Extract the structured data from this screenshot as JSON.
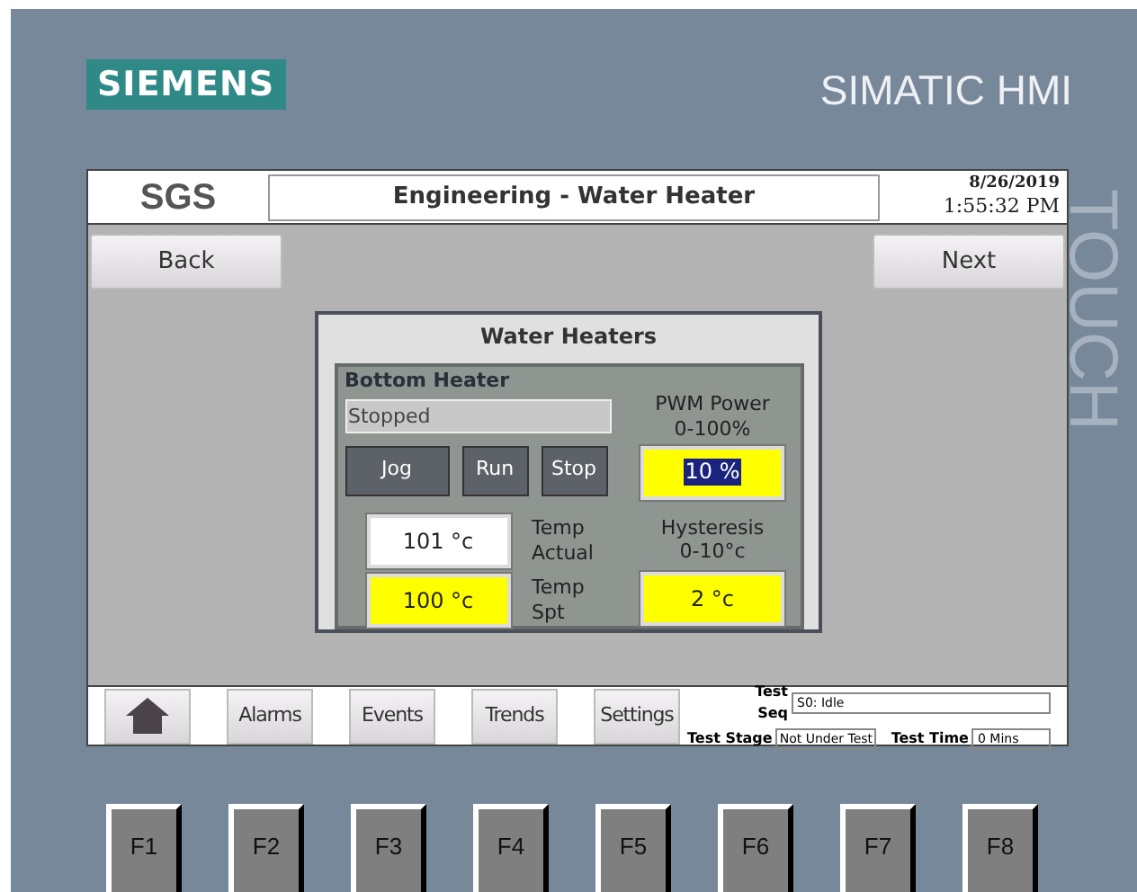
{
  "brand": {
    "logo": "SIEMENS",
    "model": "SIMATIC HMI",
    "side_label": "TOUCH"
  },
  "header": {
    "logo": "SGS",
    "title": "Engineering - Water Heater",
    "date": "8/26/2019",
    "time": "1:55:32 PM"
  },
  "nav": {
    "back": "Back",
    "next": "Next"
  },
  "dialog": {
    "title": "Water Heaters",
    "section": "Bottom Heater",
    "status": "Stopped",
    "buttons": [
      "Jog",
      "Run",
      "Stop"
    ],
    "pwm": {
      "label": "PWM Power",
      "range": "0-100%",
      "value": "10 %",
      "kind": "input",
      "selected": true
    },
    "temp_actual": {
      "value": "101 °c",
      "kind": "display",
      "label": [
        "Temp",
        "Actual"
      ]
    },
    "temp_spt": {
      "value": "100 °c",
      "kind": "input",
      "label": [
        "Temp",
        "Spt"
      ]
    },
    "hysteresis": {
      "label": "Hysteresis",
      "range": "0-10°c",
      "value": "2 °c",
      "kind": "input",
      "selected": false
    }
  },
  "footer": {
    "buttons": [
      {
        "kind": "home"
      },
      {
        "kind": "text",
        "label": "Alarms"
      },
      {
        "kind": "text",
        "label": "Events"
      },
      {
        "kind": "text",
        "label": "Trends"
      },
      {
        "kind": "text",
        "label": "Settings"
      }
    ],
    "test_seq": {
      "label": "Test Seq",
      "value": "S0: Idle"
    },
    "test_stage": {
      "label": "Test Stage",
      "value": "Not Under Test"
    },
    "test_time": {
      "label": "Test Time",
      "value": "0 Mins"
    }
  },
  "function_keys": [
    "F1",
    "F2",
    "F3",
    "F4",
    "F5",
    "F6",
    "F7",
    "F8"
  ]
}
